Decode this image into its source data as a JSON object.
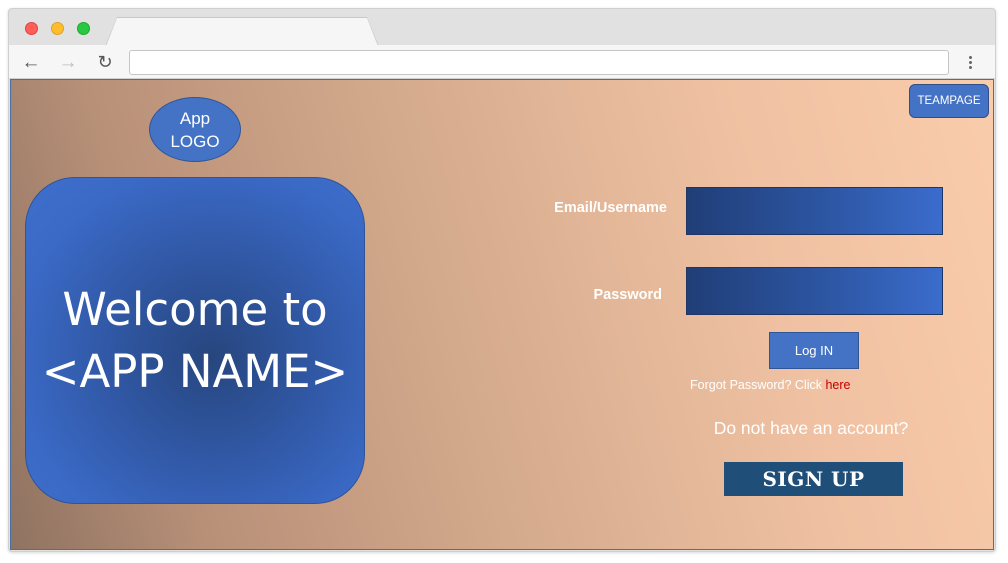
{
  "browser": {
    "address_value": ""
  },
  "header": {
    "teampage_label": "TEAMPAGE"
  },
  "logo": {
    "line1": "App",
    "line2": "LOGO"
  },
  "welcome": {
    "line1": "Welcome to",
    "line2": "<APP NAME>"
  },
  "login_form": {
    "email_label": "Email/Username",
    "email_value": "",
    "password_label": "Password",
    "password_value": "",
    "login_label": "Log IN",
    "forgot_text": "Forgot Password? Click ",
    "forgot_link": "here",
    "no_account_text": "Do not have an account?",
    "signup_label": "SIGN UP"
  },
  "colors": {
    "primary_blue": "#4472c4",
    "signup_blue": "#1f4e79",
    "link_red": "#c00000"
  },
  "icons": [
    "back-arrow-icon",
    "forward-arrow-icon",
    "reload-icon",
    "more-vertical-icon"
  ]
}
